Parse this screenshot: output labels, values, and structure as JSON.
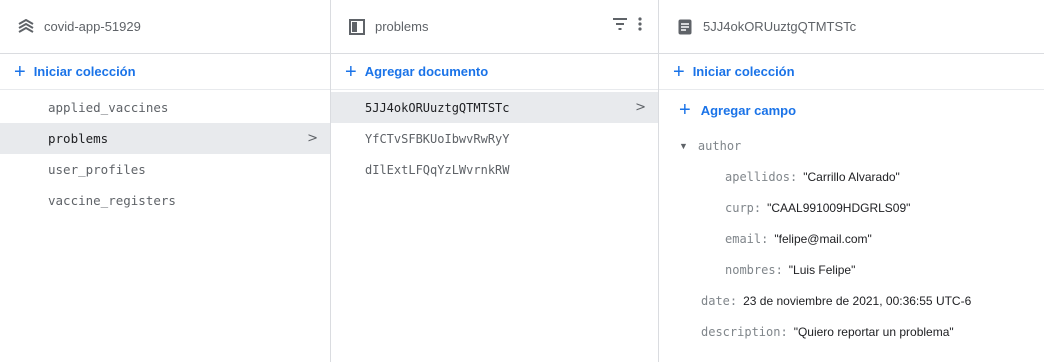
{
  "project": {
    "title": "covid-app-51929",
    "icon": "firestore-stack-icon"
  },
  "collections": {
    "action": "Iniciar colección",
    "items": [
      "applied_vaccines",
      "problems",
      "user_profiles",
      "vaccine_registers"
    ],
    "selected_index": 1
  },
  "collection_panel": {
    "title": "problems",
    "icon": "collection-icon",
    "action": "Agregar documento",
    "documents": [
      "5JJ4okORUuztgQTMTSTc",
      "YfCTvSFBKUoIbwvRwRyY",
      "dIlExtLFQqYzLWvrnkRW"
    ],
    "selected_index": 0
  },
  "document_panel": {
    "title": "5JJ4okORUuztgQTMTSTc",
    "icon": "document-icon",
    "start_collection": "Iniciar colección",
    "add_field": "Agregar campo",
    "fields": {
      "author_key": "author",
      "apellidos_key": "apellidos:",
      "apellidos_val": "\"Carrillo Alvarado\"",
      "curp_key": "curp:",
      "curp_val": "\"CAAL991009HDGRLS09\"",
      "email_key": "email:",
      "email_val": "\"felipe@mail.com\"",
      "nombres_key": "nombres:",
      "nombres_val": "\"Luis Felipe\"",
      "date_key": "date:",
      "date_val": "23 de noviembre de 2021, 00:36:55 UTC-6",
      "description_key": "description:",
      "description_val": "\"Quiero reportar un problema\""
    }
  },
  "colors": {
    "accent": "#1a73e8",
    "selected_bg": "#e8eaed",
    "border": "#dadce0"
  }
}
